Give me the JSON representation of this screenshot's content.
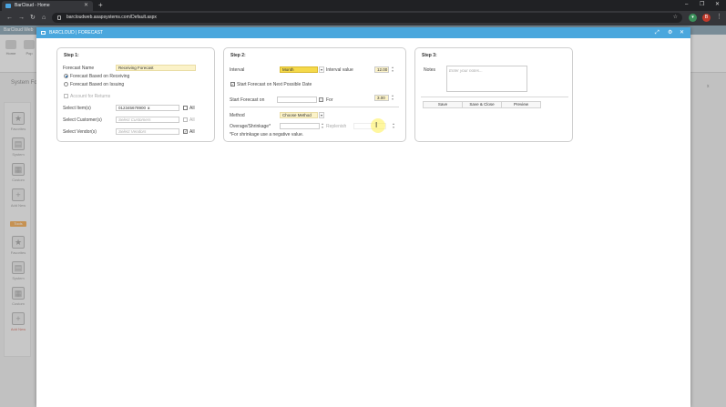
{
  "browser": {
    "tab_title": "BarCloud - Home",
    "url": "barcloudweb.asapsystems.com/Default.aspx",
    "profile_initial": "B"
  },
  "background_app": {
    "top_label": "BarCloud Web",
    "ribbon": [
      "Home",
      "Pop",
      "Hist"
    ],
    "section_label": "System Fo",
    "sidebar_top": [
      "Favorites",
      "System",
      "Custom",
      "Add New"
    ],
    "sidebar_tag": "Tools",
    "sidebar_bottom": [
      "Favorites",
      "System",
      "Custom",
      "Add New"
    ],
    "close_mark": "x"
  },
  "modal": {
    "title": "BARCLOUD | FORECAST"
  },
  "step1": {
    "title": "Step 1:",
    "forecast_name_label": "Forecast Name",
    "forecast_name_value": "Receiving Forecast",
    "radio_receiving": "Forecast Based on Receiving",
    "radio_issuing": "Forecast Based on Issuing",
    "account_returns": "Account for Returns",
    "items_label": "Select Item(s)",
    "items_value": "012345678900",
    "items_remove": "x",
    "customers_label": "Select Customer(s)",
    "customers_placeholder": "Select Customers",
    "vendors_label": "Select Vendor(s)",
    "vendors_placeholder": "Select Vendors",
    "all_label": "All"
  },
  "step2": {
    "title": "Step 2:",
    "interval_label": "Interval",
    "interval_value": "Month",
    "interval_value_label": "Interval value",
    "interval_value_value": "12.00",
    "start_next_label": "Start Forecast on Next Possible Date",
    "start_on_label": "Start Forecast on",
    "for_label": "For",
    "for_value": "3.00",
    "method_label": "Method",
    "method_value": "Choose Method",
    "overage_label": "Overage/Shrinkage*",
    "replenish_label": "Replenish",
    "note": "*For shrinkage use a negative value."
  },
  "step3": {
    "title": "Step 3:",
    "notes_label": "Notes",
    "notes_placeholder": "Enter your notes...",
    "save_label": "Save",
    "save_close_label": "Save & Close",
    "preview_label": "Preview"
  }
}
